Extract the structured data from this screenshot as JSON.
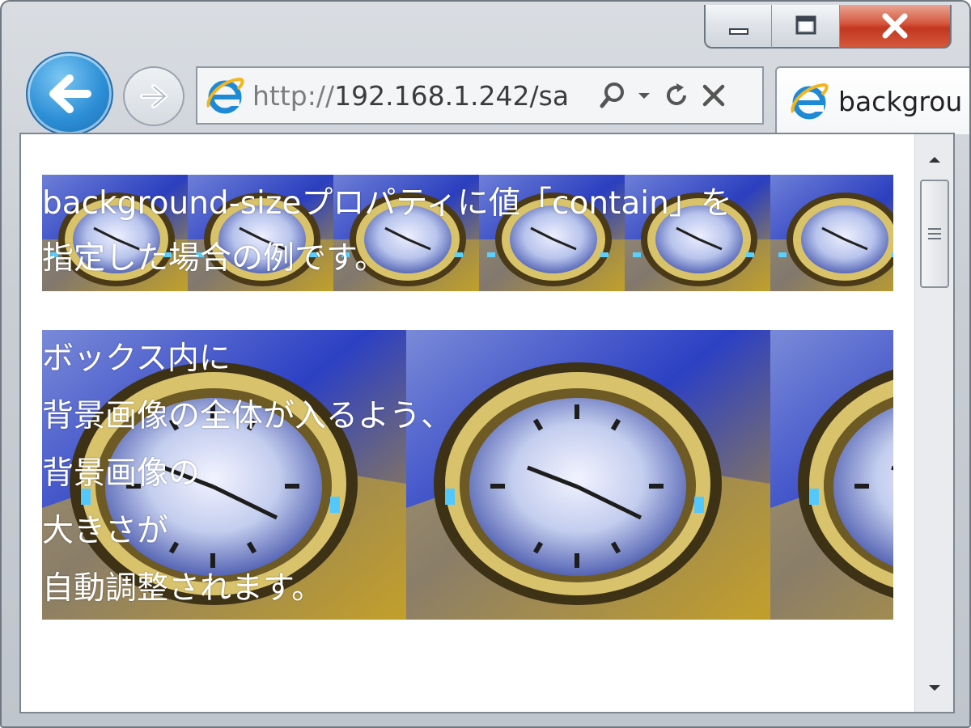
{
  "window": {
    "caption": {
      "minimize": "minimize-icon",
      "maximize": "maximize-icon",
      "close": "close-icon"
    }
  },
  "toolbar": {
    "back": "back-arrow-icon",
    "forward": "forward-arrow-icon"
  },
  "address": {
    "scheme": "http://",
    "host_path": "192.168.1.242/sa",
    "icons": [
      "ie-icon",
      "search-icon",
      "dropdown-icon",
      "refresh-icon",
      "stop-icon"
    ]
  },
  "tab": {
    "label": "backgrou"
  },
  "page": {
    "box1": {
      "lines": [
        "background-sizeプロパティに値「contain」を",
        "指定した場合の例です。"
      ]
    },
    "box2": {
      "lines": [
        "ボックス内に",
        "背景画像の全体が入るよう、",
        "背景画像の",
        "大きさが",
        "自動調整されます。"
      ]
    }
  },
  "colors": {
    "ie_blue": "#1e8ad6",
    "close_red": "#c9402a",
    "clock_blue": "#2a44c8",
    "clock_gold": "#c9a424"
  }
}
